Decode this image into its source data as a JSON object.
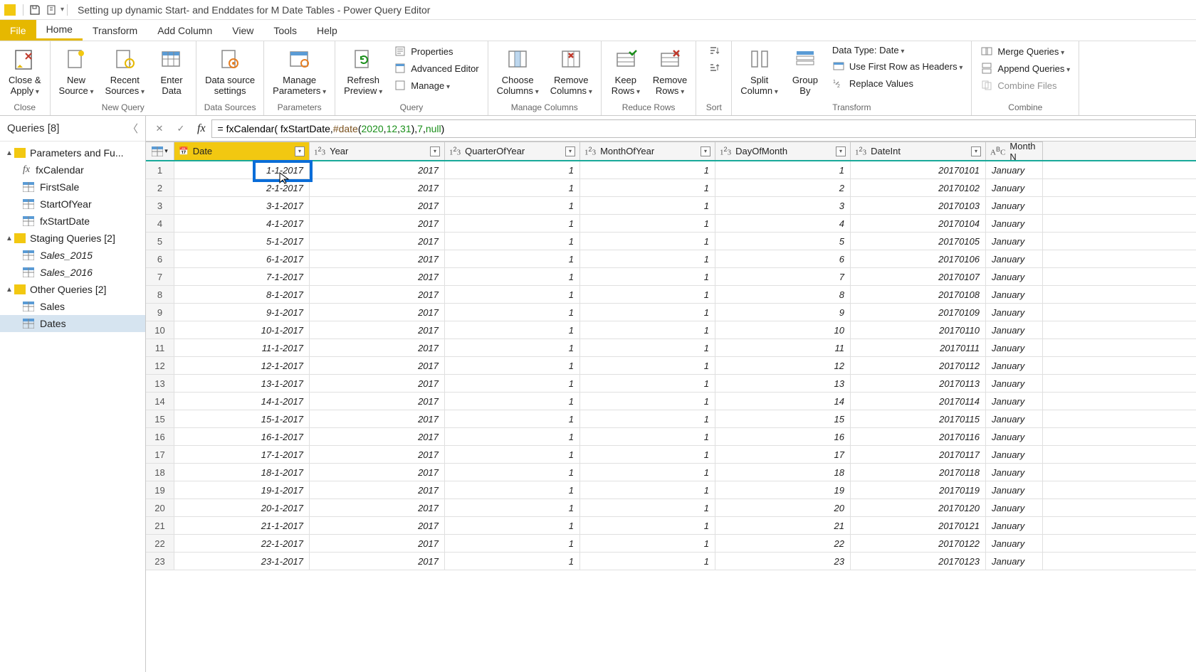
{
  "title": "Setting up dynamic Start- and Enddates for M Date Tables - Power Query Editor",
  "menu": {
    "file": "File",
    "home": "Home",
    "transform": "Transform",
    "addcol": "Add Column",
    "view": "View",
    "tools": "Tools",
    "help": "Help"
  },
  "ribbon": {
    "close": {
      "closeapply": "Close &\nApply",
      "group": "Close"
    },
    "newquery": {
      "newsource": "New\nSource",
      "recent": "Recent\nSources",
      "enter": "Enter\nData",
      "group": "New Query"
    },
    "datasources": {
      "settings": "Data source\nsettings",
      "group": "Data Sources"
    },
    "parameters": {
      "manage": "Manage\nParameters",
      "group": "Parameters"
    },
    "query": {
      "refresh": "Refresh\nPreview",
      "props": "Properties",
      "adv": "Advanced Editor",
      "manage": "Manage",
      "group": "Query"
    },
    "mcols": {
      "choose": "Choose\nColumns",
      "remove": "Remove\nColumns",
      "group": "Manage Columns"
    },
    "rrows": {
      "keep": "Keep\nRows",
      "remove": "Remove\nRows",
      "group": "Reduce Rows"
    },
    "sort": {
      "group": "Sort"
    },
    "transform": {
      "split": "Split\nColumn",
      "group_by": "Group\nBy",
      "datatype": "Data Type: Date",
      "firstrow": "Use First Row as Headers",
      "replace": "Replace Values",
      "group": "Transform"
    },
    "combine": {
      "merge": "Merge Queries",
      "append": "Append Queries",
      "combine": "Combine Files",
      "group": "Combine"
    }
  },
  "queries": {
    "header": "Queries [8]",
    "g1": "Parameters and Fu...",
    "g1_items": {
      "fxCalendar": "fxCalendar",
      "FirstSale": "FirstSale",
      "StartOfYear": "StartOfYear",
      "fxStartDate": "fxStartDate"
    },
    "g2": "Staging Queries [2]",
    "g2_items": {
      "s2015": "Sales_2015",
      "s2016": "Sales_2016"
    },
    "g3": "Other Queries [2]",
    "g3_items": {
      "sales": "Sales",
      "dates": "Dates"
    }
  },
  "formula": {
    "prefix": "= fxCalendar( fxStartDate, ",
    "datekw": "#date",
    "paren_open": "( ",
    "n1": "2020",
    "c1": ", ",
    "n2": "12",
    "c2": ", ",
    "n3": "31",
    "paren_close": "), ",
    "n4": "7",
    "c3": ", ",
    "nullkw": "null",
    "end": ")"
  },
  "columns": {
    "date": "Date",
    "year": "Year",
    "quarter": "QuarterOfYear",
    "month": "MonthOfYear",
    "day": "DayOfMonth",
    "dateint": "DateInt",
    "monthname": "Month N"
  },
  "rows": [
    {
      "n": "1",
      "date": "1-1-2017",
      "year": "2017",
      "q": "1",
      "m": "1",
      "d": "1",
      "di": "20170101",
      "mn": "January"
    },
    {
      "n": "2",
      "date": "2-1-2017",
      "year": "2017",
      "q": "1",
      "m": "1",
      "d": "2",
      "di": "20170102",
      "mn": "January"
    },
    {
      "n": "3",
      "date": "3-1-2017",
      "year": "2017",
      "q": "1",
      "m": "1",
      "d": "3",
      "di": "20170103",
      "mn": "January"
    },
    {
      "n": "4",
      "date": "4-1-2017",
      "year": "2017",
      "q": "1",
      "m": "1",
      "d": "4",
      "di": "20170104",
      "mn": "January"
    },
    {
      "n": "5",
      "date": "5-1-2017",
      "year": "2017",
      "q": "1",
      "m": "1",
      "d": "5",
      "di": "20170105",
      "mn": "January"
    },
    {
      "n": "6",
      "date": "6-1-2017",
      "year": "2017",
      "q": "1",
      "m": "1",
      "d": "6",
      "di": "20170106",
      "mn": "January"
    },
    {
      "n": "7",
      "date": "7-1-2017",
      "year": "2017",
      "q": "1",
      "m": "1",
      "d": "7",
      "di": "20170107",
      "mn": "January"
    },
    {
      "n": "8",
      "date": "8-1-2017",
      "year": "2017",
      "q": "1",
      "m": "1",
      "d": "8",
      "di": "20170108",
      "mn": "January"
    },
    {
      "n": "9",
      "date": "9-1-2017",
      "year": "2017",
      "q": "1",
      "m": "1",
      "d": "9",
      "di": "20170109",
      "mn": "January"
    },
    {
      "n": "10",
      "date": "10-1-2017",
      "year": "2017",
      "q": "1",
      "m": "1",
      "d": "10",
      "di": "20170110",
      "mn": "January"
    },
    {
      "n": "11",
      "date": "11-1-2017",
      "year": "2017",
      "q": "1",
      "m": "1",
      "d": "11",
      "di": "20170111",
      "mn": "January"
    },
    {
      "n": "12",
      "date": "12-1-2017",
      "year": "2017",
      "q": "1",
      "m": "1",
      "d": "12",
      "di": "20170112",
      "mn": "January"
    },
    {
      "n": "13",
      "date": "13-1-2017",
      "year": "2017",
      "q": "1",
      "m": "1",
      "d": "13",
      "di": "20170113",
      "mn": "January"
    },
    {
      "n": "14",
      "date": "14-1-2017",
      "year": "2017",
      "q": "1",
      "m": "1",
      "d": "14",
      "di": "20170114",
      "mn": "January"
    },
    {
      "n": "15",
      "date": "15-1-2017",
      "year": "2017",
      "q": "1",
      "m": "1",
      "d": "15",
      "di": "20170115",
      "mn": "January"
    },
    {
      "n": "16",
      "date": "16-1-2017",
      "year": "2017",
      "q": "1",
      "m": "1",
      "d": "16",
      "di": "20170116",
      "mn": "January"
    },
    {
      "n": "17",
      "date": "17-1-2017",
      "year": "2017",
      "q": "1",
      "m": "1",
      "d": "17",
      "di": "20170117",
      "mn": "January"
    },
    {
      "n": "18",
      "date": "18-1-2017",
      "year": "2017",
      "q": "1",
      "m": "1",
      "d": "18",
      "di": "20170118",
      "mn": "January"
    },
    {
      "n": "19",
      "date": "19-1-2017",
      "year": "2017",
      "q": "1",
      "m": "1",
      "d": "19",
      "di": "20170119",
      "mn": "January"
    },
    {
      "n": "20",
      "date": "20-1-2017",
      "year": "2017",
      "q": "1",
      "m": "1",
      "d": "20",
      "di": "20170120",
      "mn": "January"
    },
    {
      "n": "21",
      "date": "21-1-2017",
      "year": "2017",
      "q": "1",
      "m": "1",
      "d": "21",
      "di": "20170121",
      "mn": "January"
    },
    {
      "n": "22",
      "date": "22-1-2017",
      "year": "2017",
      "q": "1",
      "m": "1",
      "d": "22",
      "di": "20170122",
      "mn": "January"
    },
    {
      "n": "23",
      "date": "23-1-2017",
      "year": "2017",
      "q": "1",
      "m": "1",
      "d": "23",
      "di": "20170123",
      "mn": "January"
    }
  ]
}
